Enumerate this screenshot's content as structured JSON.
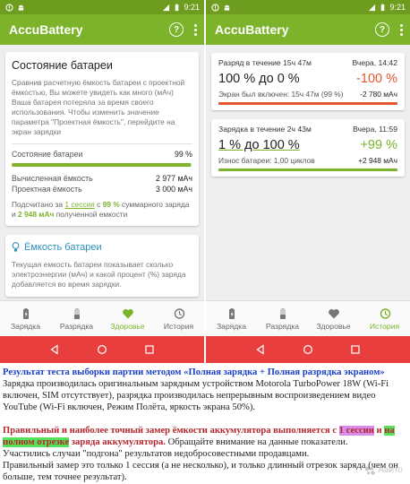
{
  "statusbar": {
    "time": "9:21"
  },
  "app": {
    "title": "AccuBattery"
  },
  "left": {
    "health_card": {
      "title": "Состояние батареи",
      "description": "Сравнив расчетную ёмкость батареи с проектной ёмкостью, Вы можете увидеть как много (мАч) Ваша батарея потеряла за время своего использования. Чтобы изменить значение параметра \"Проектная ёмкость\", перейдите на экран зарядки",
      "health_label": "Состояние батареи",
      "health_value": "99 %",
      "health_fraction": 0.99,
      "calc_label": "Вычисленная ёмкость",
      "calc_value": "2 977 мАч",
      "design_label": "Проектная ёмкость",
      "design_value": "3 000 мАч",
      "note_a": "Подсчитано за ",
      "note_b": "1 сессия",
      "note_c": " с ",
      "note_d": "99 %",
      "note_e": " суммарного заряда и ",
      "note_f": "2 948 мАч",
      "note_g": " полученной емкости"
    },
    "capacity_card": {
      "title": "Ёмкость батареи",
      "description": "Текущая емкость батареи показывает сколько электроэнергии (мАч) и какой процент (%) заряда добавляется во время зарядки."
    }
  },
  "right": {
    "discharge": {
      "header": "Разряд в течение 15ч 47м",
      "date": "Вчера, 14:42",
      "range": "100 % до 0 %",
      "percent": "-100 %",
      "sub_label": "Экран был включен: 15ч 47м (99 %)",
      "sub_value": "-2 780 мАч",
      "color": "#e4572e"
    },
    "charge": {
      "header": "Зарядка в течение 2ч 43м",
      "date": "Вчера, 11:59",
      "range": "1 % до 100 %",
      "percent": "+99 %",
      "sub_label": "Износ батареи: 1,00 циклов",
      "sub_value": "+2 948 мАч",
      "color": "#7cb32a"
    }
  },
  "nav": {
    "items": [
      "Зарядка",
      "Разрядка",
      "Здоровье",
      "История"
    ]
  },
  "article": {
    "heading": "Результат теста выборки партии методом «Полная зарядка + Полная разрядка экраном»",
    "p1": "Зарядка производилась оригинальным зарядным устройством Motorola TurboPower 18W (Wi-Fi включен, SIM отсутствует), разрядка производилась непрерывным воспроизведением видео YouTube (Wi-Fi включен, Режим Полёта, яркость экрана 50%).",
    "p2_a": "Правильный и наиболее точный замер ёмкости аккумулятора выполняется с ",
    "p2_b": "1 сессии",
    "p2_c": " и ",
    "p2_d": "на полном отрезке",
    "p2_e": " заряда аккумулятора.",
    "p2_f": " Обращайте внимание на данные показатели.",
    "p3": "Участились случаи \"подгона\" результатов недобросовестными продавцами.",
    "p4": "Правильный замер это только 1 сессия (а не несколько), и только длинный отрезок заряда (чем он больше, тем точнее результат).",
    "watermark": "Авито"
  },
  "colors": {
    "green": "#7cb32a",
    "dark_green": "#6e9c1f",
    "red": "#e83e3e",
    "blue": "#2a8fbd"
  }
}
